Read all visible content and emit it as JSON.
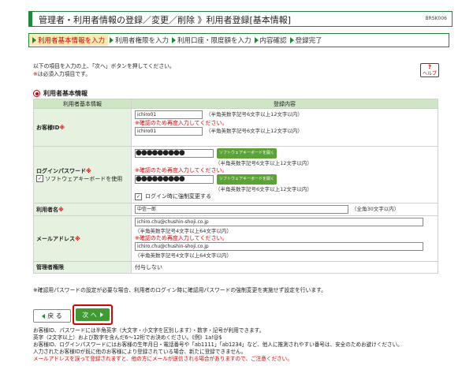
{
  "header": {
    "title": "管理者・利用者情報の登録／変更／削除 》利用者登録[基本情報]",
    "code": "BRSK006"
  },
  "steps": [
    "利用者基本情報を入力",
    "利用者権限を入力",
    "利用口座・限度額を入力",
    "内容確認",
    "登録完了"
  ],
  "intro": {
    "line1": "以下の項目を入力の上、「次へ」ボタンを押してください。",
    "required_mark": "※",
    "line2": "は必須入力項目です。"
  },
  "help": {
    "label": "ヘルプ",
    "mark": "?"
  },
  "section_title": "利用者基本情報",
  "table": {
    "col1": "利用者基本情報",
    "col2": "登録内容",
    "user_id": {
      "label": "お客様ID",
      "value": "ichiro01",
      "hint": "（半角英数字記号6文字以上12文字以内）",
      "confirm_warn": "※確認のため再度入力してください。",
      "confirm_value": "ichiro01"
    },
    "password": {
      "label": "ログインパスワード",
      "mask": "●●●●●●●●●",
      "keyboard_btn": "ソフトウェアキーボードを開く",
      "hint": "（半角英数字記号6文字以上12文字以内）",
      "software_kb_label": "ソフトウェアキーボードを使用",
      "confirm_warn": "※確認のため再度入力してください。",
      "force_change_label": "ログイン時に強制変更する"
    },
    "user_name": {
      "label": "利用者名",
      "value": "中信一郎",
      "hint": "（全角30文字以内）"
    },
    "email": {
      "label": "メールアドレス",
      "value": "ichiro.chu@chushin-shoji.co.jp",
      "hint": "（半角英数字記号4文字以上64文字以内）",
      "confirm_warn": "※確認のため再度入力してください。",
      "confirm_value": "ichiro.chu@chushin-shoji.co.jp"
    },
    "admin": {
      "label": "管理者権限",
      "value": "付与しない"
    }
  },
  "note": "※確認用パスワードの設定が必要な場合、利用者のログイン時に確認用パスワードの強制変更を実施せず設定を行います。",
  "buttons": {
    "back": "戻 る",
    "next": "次 へ"
  },
  "footer": [
    "お客様ID、パスワードには半角英字（大文字・小文字を区別します）・数字・記号が利用できます。",
    "英字（2文字以上）および数字を含んだ6〜12桁でお決めください。《例》1a!@$",
    "お客様ID、ログインパスワードにはお客様の生年月日・電話番号や「ab1111」「ab1234」など、他人に推測されやすい番号は、安全のためお避けください。",
    "入力されたお客様IDが既に他のお客様により登録されている場合、新たに登録できません。",
    "メールアドレスを誤って登録されますと、他の方にメールが送信される場合がありますので、ご注意ください。"
  ]
}
